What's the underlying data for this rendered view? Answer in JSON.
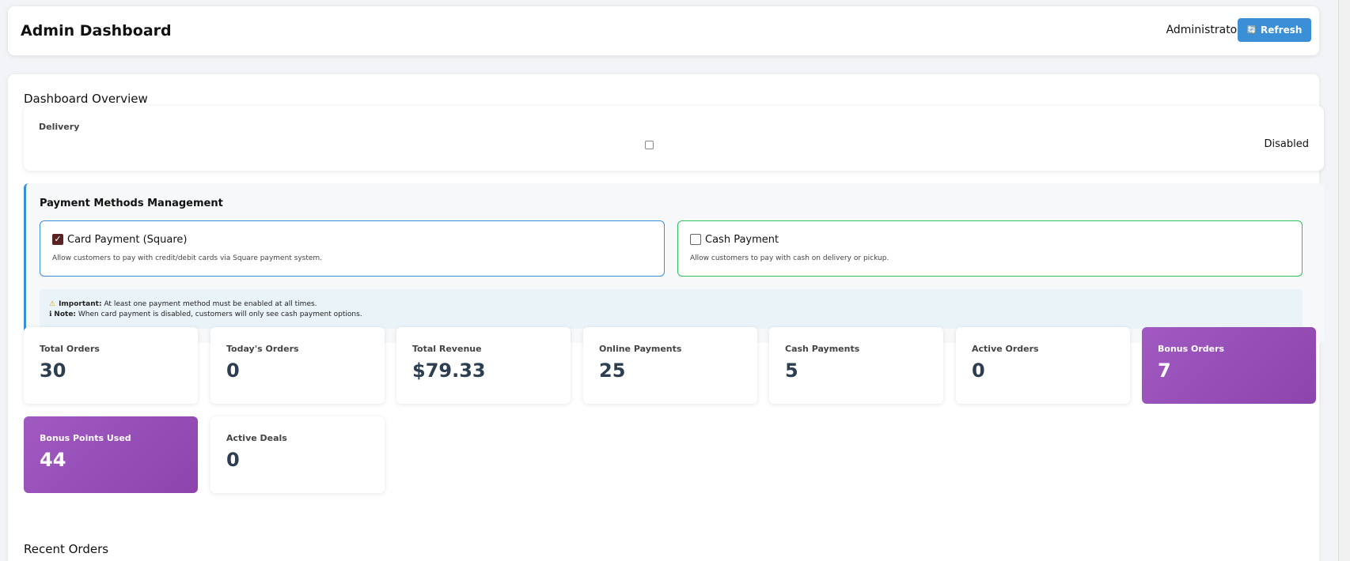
{
  "header": {
    "title": "Admin Dashboard",
    "user": "Administrator",
    "refresh_icon": "🔄",
    "refresh_label": "Refresh"
  },
  "overview": {
    "title": "Dashboard Overview"
  },
  "delivery": {
    "label": "Delivery",
    "status": "Disabled",
    "checked": false
  },
  "payment": {
    "title": "Payment Methods Management",
    "methods": [
      {
        "name": "Card Payment (Square)",
        "description": "Allow customers to pay with credit/debit cards via Square payment system.",
        "checked": true
      },
      {
        "name": "Cash Payment",
        "description": "Allow customers to pay with cash on delivery or pickup.",
        "checked": false
      }
    ],
    "important_label": "Important:",
    "important_text": "At least one payment method must be enabled at all times.",
    "note_label": "Note:",
    "note_text": "When card payment is disabled, customers will only see cash payment options."
  },
  "stats": [
    {
      "label": "Total Orders",
      "value": "30"
    },
    {
      "label": "Today's Orders",
      "value": "0"
    },
    {
      "label": "Total Revenue",
      "value": "$79.33"
    },
    {
      "label": "Online Payments",
      "value": "25"
    },
    {
      "label": "Cash Payments",
      "value": "5"
    },
    {
      "label": "Active Orders",
      "value": "0"
    },
    {
      "label": "Bonus Orders",
      "value": "7"
    },
    {
      "label": "Bonus Points Used",
      "value": "44"
    },
    {
      "label": "Active Deals",
      "value": "0"
    }
  ],
  "recent_orders": {
    "title": "Recent Orders"
  },
  "colors": {
    "accent": "#3b8fd6",
    "success": "#2fbf5c",
    "purple": "#8e44ad",
    "stat_value": "#2c3e50"
  }
}
